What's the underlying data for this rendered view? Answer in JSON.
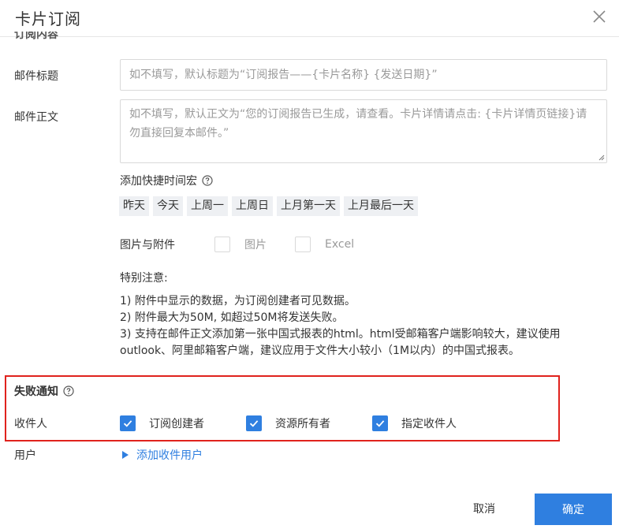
{
  "dialog": {
    "title": "卡片订阅",
    "close_icon": "close-icon"
  },
  "content_section": {
    "heading": "订阅内容"
  },
  "mail_subject": {
    "label": "邮件标题",
    "value": "",
    "placeholder": "如不填写，默认标题为“订阅报告——{卡片名称} {发送日期}”"
  },
  "mail_body": {
    "label": "邮件正文",
    "value": "",
    "placeholder": "如不填写，默认正文为“您的订阅报告已生成，请查看。卡片详情请点击: {卡片详情页链接}请勿直接回复本邮件。”"
  },
  "time_macros": {
    "label": "添加快捷时间宏",
    "help_icon": "question-circle-icon",
    "items": [
      "昨天",
      "今天",
      "上周一",
      "上周日",
      "上月第一天",
      "上月最后一天"
    ]
  },
  "attachments": {
    "label": "图片与附件",
    "options": [
      {
        "label": "图片",
        "checked": false
      },
      {
        "label": "Excel",
        "checked": false
      }
    ]
  },
  "notice": {
    "title": "特别注意:",
    "lines": [
      "1) 附件中显示的数据，为订阅创建者可见数据。",
      "2) 附件最大为50M, 如超过50M将发送失败。",
      "3) 支持在邮件正文添加第一张中国式报表的html。html受邮箱客户端影响较大，建议使用outlook、阿里邮箱客户端，建议应用于文件大小较小（1M以内）的中国式报表。"
    ]
  },
  "failure_notice": {
    "title": "失败通知",
    "help_icon": "question-circle-icon",
    "recipients_label": "收件人",
    "options": [
      {
        "label": "订阅创建者",
        "checked": true
      },
      {
        "label": "资源所有者",
        "checked": true
      },
      {
        "label": "指定收件人",
        "checked": true
      }
    ]
  },
  "users": {
    "label": "用户",
    "add_label": "添加收件用户"
  },
  "footer": {
    "cancel_label": "取消",
    "ok_label": "确定"
  },
  "colors": {
    "primary": "#2f7fe0",
    "highlight_border": "#e0221d",
    "chip_bg": "#eef0f3"
  }
}
